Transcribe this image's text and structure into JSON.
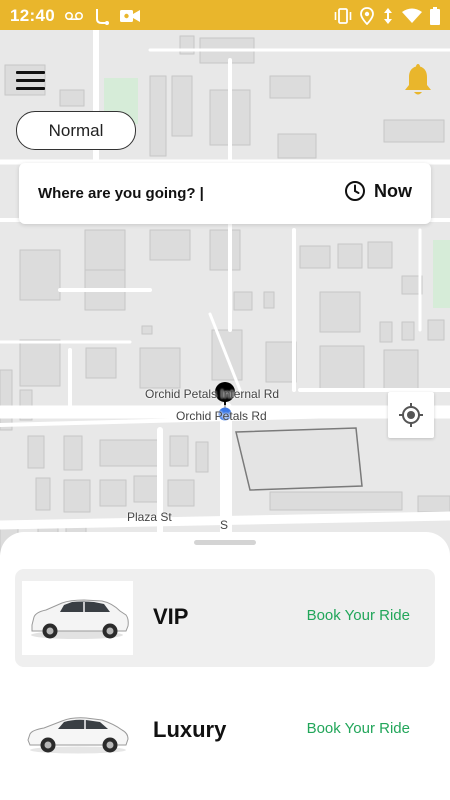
{
  "status_bar": {
    "time": "12:40",
    "left_icons": [
      "voicemail-icon",
      "route-icon",
      "video-camera-icon"
    ],
    "right_icons": [
      "vibrate-icon",
      "location-pin-icon",
      "data-arrows-icon",
      "wifi-icon",
      "battery-icon"
    ]
  },
  "map": {
    "street_labels": [
      "Orchid Petals Internal Rd",
      "Orchid Petals Rd",
      "Plaza St",
      "S"
    ]
  },
  "header": {
    "menu_icon": "hamburger-menu-icon",
    "notification_icon": "bell-icon",
    "mode_label": "Normal"
  },
  "search": {
    "placeholder": "Where are you going? |",
    "schedule_label": "Now",
    "schedule_icon": "clock-icon"
  },
  "rides": [
    {
      "name": "VIP",
      "action": "Book Your Ride",
      "selected": true
    },
    {
      "name": "Luxury",
      "action": "Book Your Ride",
      "selected": false
    }
  ],
  "colors": {
    "status_bar": "#e9b62c",
    "bell": "#e9b62c",
    "book_text": "#22a65a",
    "selected_row": "#efefef"
  }
}
